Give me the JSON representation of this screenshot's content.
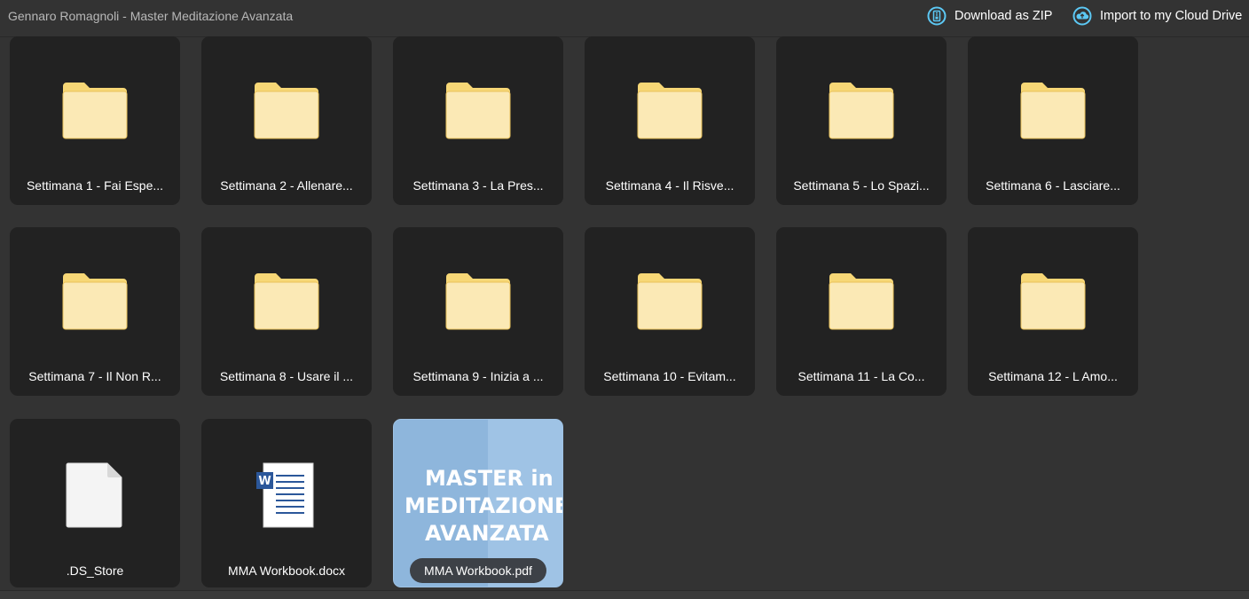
{
  "header": {
    "title": "Gennaro Romagnoli - Master Meditazione Avanzata",
    "download_label": "Download as ZIP",
    "import_label": "Import to my Cloud Drive",
    "download_icon": "zip-archive-icon",
    "import_icon": "cloud-upload-icon",
    "accent_color": "#5cc8f4"
  },
  "items": {
    "f1": {
      "label": "Settimana 1 - Fai Espe...",
      "type": "folder"
    },
    "f2": {
      "label": "Settimana 2 - Allenare...",
      "type": "folder"
    },
    "f3": {
      "label": "Settimana 3 - La Pres...",
      "type": "folder"
    },
    "f4": {
      "label": "Settimana 4 - Il Risve...",
      "type": "folder"
    },
    "f5": {
      "label": "Settimana 5 - Lo Spazi...",
      "type": "folder"
    },
    "f6": {
      "label": "Settimana 6 - Lasciare...",
      "type": "folder"
    },
    "f7": {
      "label": "Settimana 7 - Il Non R...",
      "type": "folder"
    },
    "f8": {
      "label": "Settimana 8 - Usare il ...",
      "type": "folder"
    },
    "f9": {
      "label": "Settimana 9 - Inizia a ...",
      "type": "folder"
    },
    "f10": {
      "label": "Settimana 10 - Evitam...",
      "type": "folder"
    },
    "f11": {
      "label": "Settimana 11 - La Co...",
      "type": "folder"
    },
    "f12": {
      "label": "Settimana 12 - L Amo...",
      "type": "folder"
    },
    "ds": {
      "label": ".DS_Store",
      "type": "file"
    },
    "docx": {
      "label": "MMA Workbook.docx",
      "type": "word-document"
    },
    "pdf": {
      "label": "MMA Workbook.pdf",
      "type": "pdf",
      "cover_lines": [
        "MASTER in",
        "MEDITAZIONE",
        "AVANZATA"
      ]
    }
  },
  "colors": {
    "folder_fill": "#fbe9b5",
    "folder_tab": "#f7d776",
    "folder_edge": "#e8c15a",
    "word_blue": "#2b579a"
  }
}
